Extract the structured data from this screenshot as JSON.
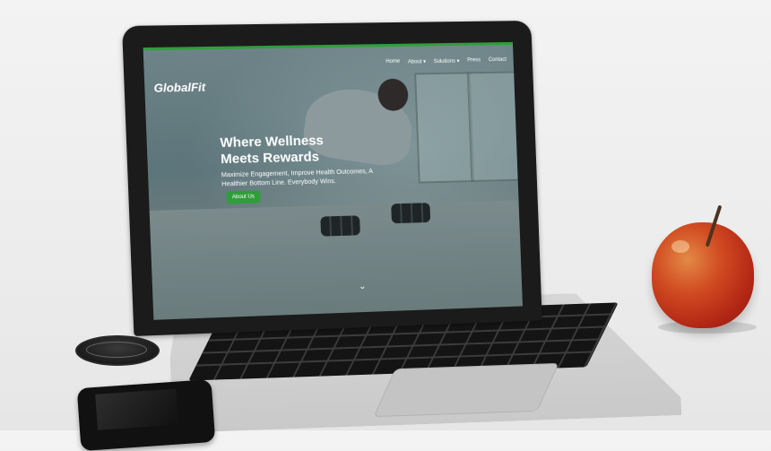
{
  "site": {
    "logo_text": "GlobalFit",
    "nav": [
      "Home",
      "About ▾",
      "Solutions ▾",
      "Press",
      "Contact"
    ],
    "hero": {
      "title_line1": "Where Wellness",
      "title_line2": "Meets Rewards",
      "subtitle": "Maximize Engagement, Improve Health Outcomes, A Healthier Bottom Line. Everybody Wins.",
      "cta_label": "About Us"
    },
    "scroll_icon": "chevron-down-icon",
    "accent_color": "#2f9e3a"
  },
  "props": {
    "lens_cap_icon": "lens-cap",
    "phone_icon": "smartphone",
    "apple_icon": "apple-fruit"
  }
}
